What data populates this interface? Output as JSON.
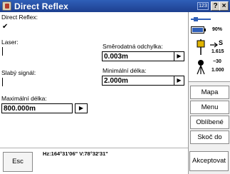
{
  "window": {
    "title": "Direct Reflex",
    "mode_indicator": "123",
    "help_btn": "?",
    "min_btn": "−",
    "close_btn": "×"
  },
  "form": {
    "direct_reflex_label": "Direct Reflex:",
    "direct_reflex_checked": "✔",
    "laser_label": "Laser:",
    "weak_signal_label": "Slabý signál:",
    "std_dev_label": "Směrodatná odchylka:",
    "std_dev_value": "0.003m",
    "min_length_label": "Minimální délka:",
    "min_length_value": "2.000m",
    "max_length_label": "Maximální délka:",
    "max_length_value": "800.000m",
    "dropdown_arrow": "▶"
  },
  "status": {
    "battery_percent": "90%",
    "prism_symbol": "S",
    "prism_height": "1.615",
    "station_value": "−30",
    "station_height": "1.000"
  },
  "side_buttons": {
    "map": "Mapa",
    "menu": "Menu",
    "favorites": "Oblíbené",
    "jump_to": "Skoč do"
  },
  "bottom": {
    "esc_label": "Esc",
    "coordinates": "Hz:164°31'06\"  V:78°32'31\"",
    "accept_label": "Akceptovat"
  },
  "colors": {
    "titlebar": "#2f5fb8",
    "panel_bg": "#f0f0f0"
  }
}
